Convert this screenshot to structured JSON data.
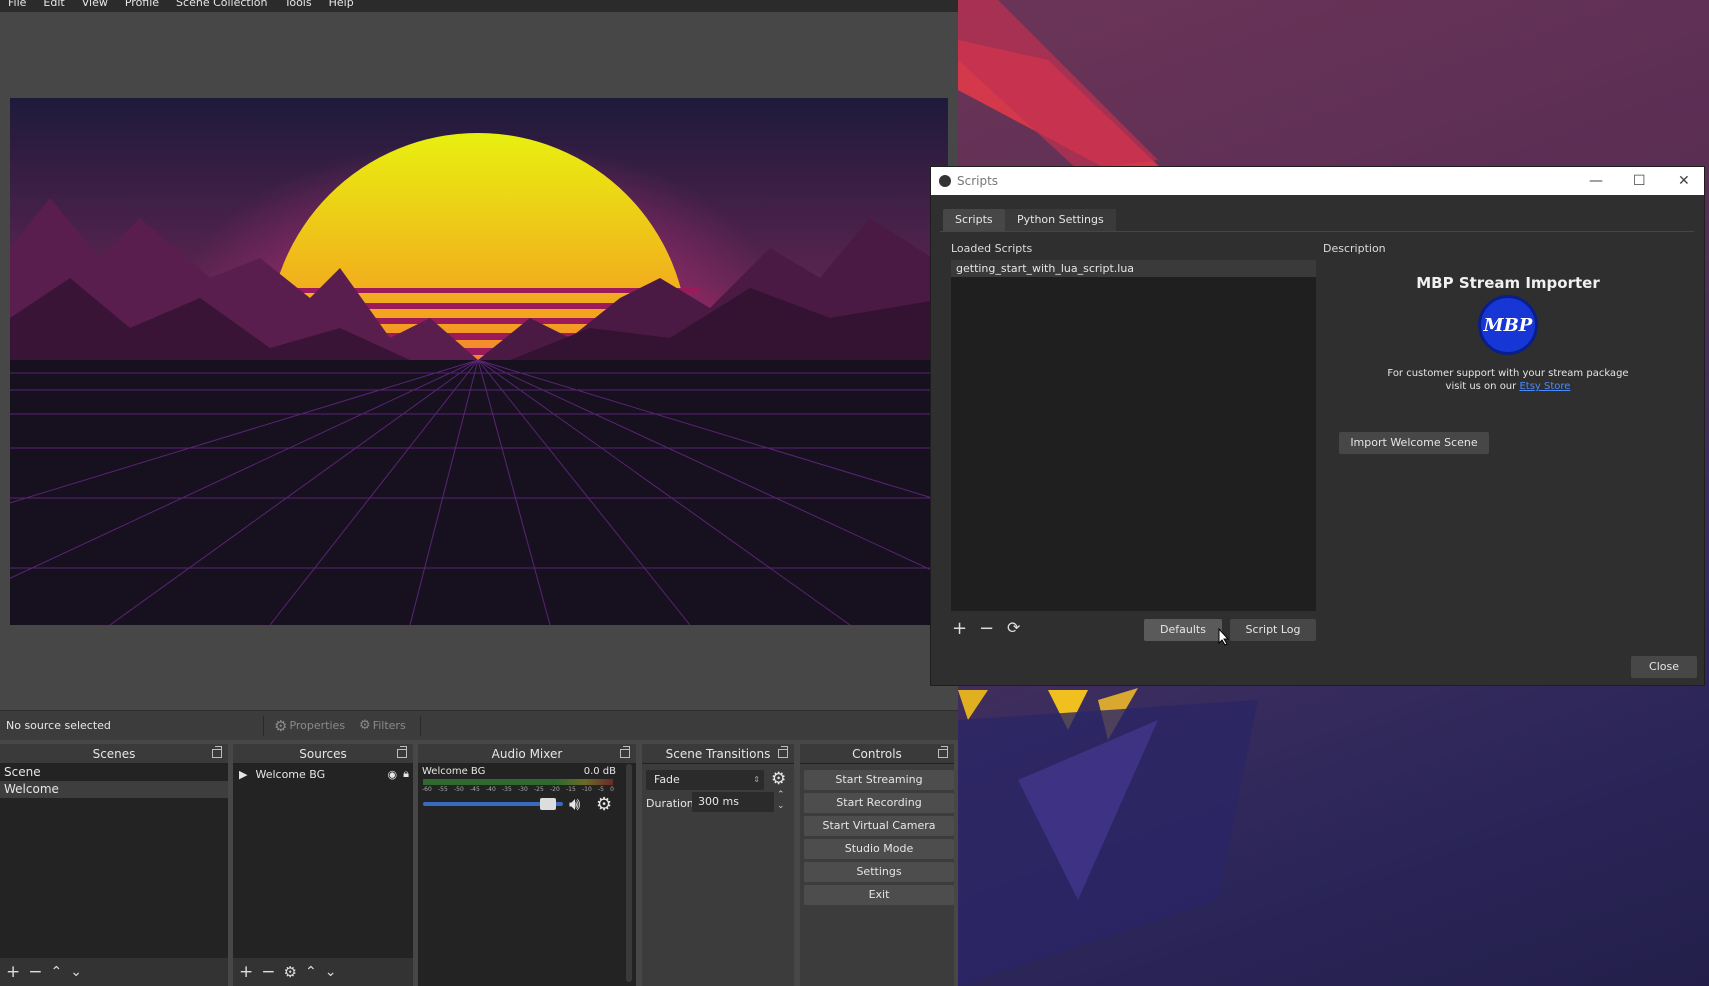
{
  "menu": [
    "File",
    "Edit",
    "View",
    "Profile",
    "Scene Collection",
    "Tools",
    "Help"
  ],
  "status": {
    "no_source": "No source selected",
    "properties": "Properties",
    "filters": "Filters"
  },
  "scenes": {
    "title": "Scenes",
    "items": [
      "Scene",
      "Welcome"
    ],
    "selected": "Welcome"
  },
  "sources": {
    "title": "Sources",
    "items": [
      "Welcome BG"
    ]
  },
  "mixer": {
    "title": "Audio Mixer",
    "channel": "Welcome BG",
    "level": "0.0 dB",
    "scale": [
      "-60",
      "-55",
      "-50",
      "-45",
      "-40",
      "-35",
      "-30",
      "-25",
      "-20",
      "-15",
      "-10",
      "-5",
      "0"
    ],
    "volume": 0.95
  },
  "transitions": {
    "title": "Scene Transitions",
    "selected": "Fade",
    "duration_label": "Duration",
    "duration_value": "300 ms"
  },
  "controls": {
    "title": "Controls",
    "buttons": [
      "Start Streaming",
      "Start Recording",
      "Start Virtual Camera",
      "Studio Mode",
      "Settings",
      "Exit"
    ]
  },
  "scripts_window": {
    "title": "Scripts",
    "tabs": [
      "Scripts",
      "Python Settings"
    ],
    "loaded_label": "Loaded Scripts",
    "loaded_items": [
      "getting_start_with_lua_script.lua"
    ],
    "description_label": "Description",
    "desc_title": "MBP Stream Importer",
    "logo_text": "MBP",
    "desc_line1": "For customer support with your stream package",
    "desc_line2_prefix": "visit us on our",
    "desc_link": "Etsy Store",
    "import_button": "Import Welcome Scene",
    "defaults_button": "Defaults",
    "script_log_button": "Script Log",
    "close_button": "Close"
  },
  "colors": {
    "accent_link": "#4a8cff",
    "logo_blue": "#1736d6",
    "app_bg": "#474747"
  }
}
